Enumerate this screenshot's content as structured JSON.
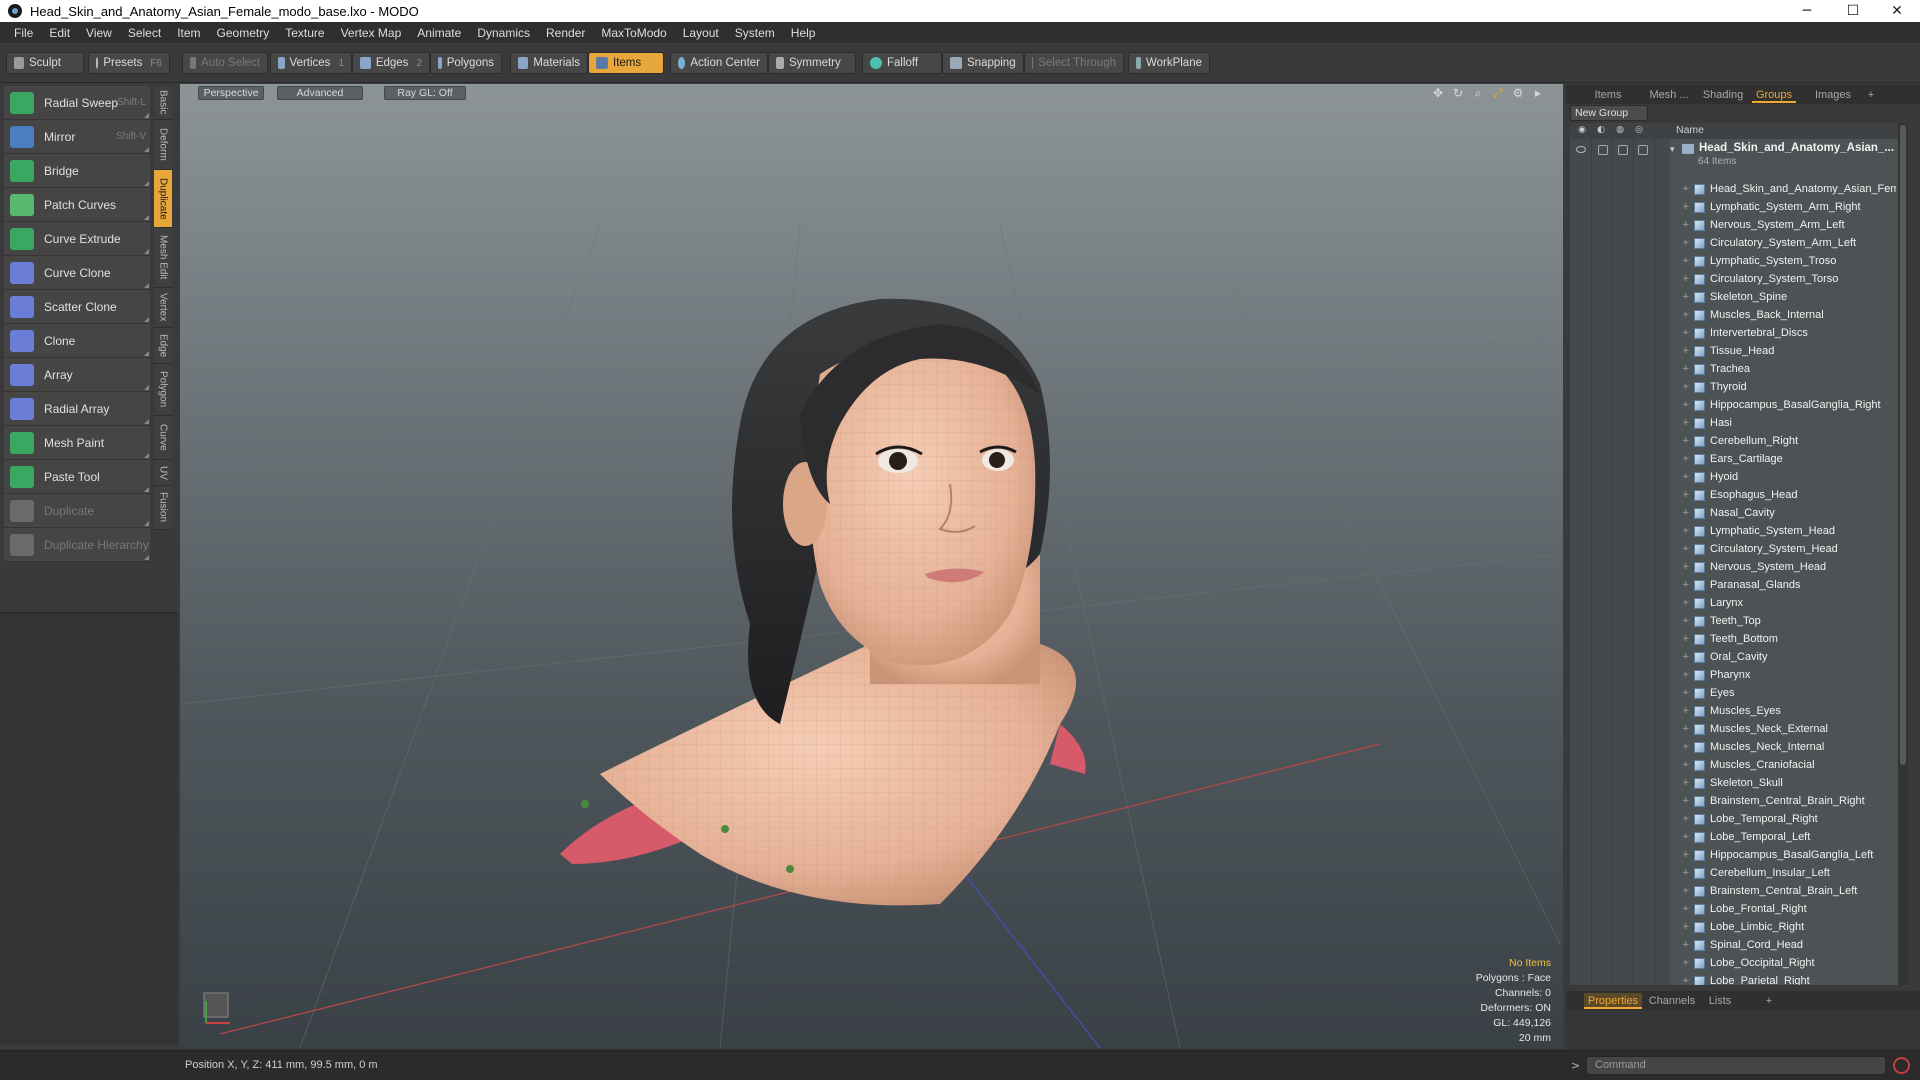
{
  "window": {
    "title": "Head_Skin_and_Anatomy_Asian_Female_modo_base.lxo - MODO",
    "minimize_glyph": "─",
    "maximize_glyph": "☐",
    "close_glyph": "✕"
  },
  "menu": [
    "File",
    "Edit",
    "View",
    "Select",
    "Item",
    "Geometry",
    "Texture",
    "Vertex Map",
    "Animate",
    "Dynamics",
    "Render",
    "MaxToModo",
    "Layout",
    "System",
    "Help"
  ],
  "toolbar": {
    "sculpt": "Sculpt",
    "presets": "Presets",
    "presets_shortcut": "F6",
    "auto_select": "Auto Select",
    "vertices": "Vertices",
    "vertices_num": "1",
    "edges": "Edges",
    "edges_num": "2",
    "polygons": "Polygons",
    "materials": "Materials",
    "items": "Items",
    "action_center": "Action Center",
    "symmetry": "Symmetry",
    "falloff": "Falloff",
    "snapping": "Snapping",
    "select_through": "Select Through",
    "workplane": "WorkPlane"
  },
  "tools": [
    {
      "label": "Radial Sweep",
      "shortcut": "Shift-L",
      "color": "#3aa860"
    },
    {
      "label": "Mirror",
      "shortcut": "Shift-V",
      "color": "#4a7ec0"
    },
    {
      "label": "Bridge",
      "shortcut": "",
      "color": "#3aa860"
    },
    {
      "label": "Patch Curves",
      "shortcut": "",
      "color": "#58b870"
    },
    {
      "label": "Curve Extrude",
      "shortcut": "",
      "color": "#3aa860"
    },
    {
      "label": "Curve Clone",
      "shortcut": "",
      "color": "#6a7ed8"
    },
    {
      "label": "Scatter Clone",
      "shortcut": "",
      "color": "#6a7ed8"
    },
    {
      "label": "Clone",
      "shortcut": "",
      "color": "#6a7ed8"
    },
    {
      "label": "Array",
      "shortcut": "",
      "color": "#6a7ed8"
    },
    {
      "label": "Radial Array",
      "shortcut": "",
      "color": "#6a7ed8"
    },
    {
      "label": "Mesh Paint",
      "shortcut": "",
      "color": "#3aa860"
    },
    {
      "label": "Paste Tool",
      "shortcut": "",
      "color": "#3aa860"
    },
    {
      "label": "Duplicate",
      "shortcut": "",
      "color": "#6a6a6a",
      "disabled": true
    },
    {
      "label": "Duplicate Hierarchy",
      "shortcut": "",
      "color": "#6a6a6a",
      "disabled": true
    }
  ],
  "vertical_tabs": [
    {
      "label": "Basic"
    },
    {
      "label": "Deform"
    },
    {
      "label": "Duplicate",
      "active": true
    },
    {
      "label": "Mesh Edit"
    },
    {
      "label": "Vertex"
    },
    {
      "label": "Edge"
    },
    {
      "label": "Polygon"
    },
    {
      "label": "Curve"
    },
    {
      "label": "UV"
    },
    {
      "label": "Fusion"
    }
  ],
  "viewport": {
    "tabs": [
      "Perspective",
      "Advanced",
      "Ray GL: Off"
    ],
    "info": {
      "no_items": "No Items",
      "polygons": "Polygons : Face",
      "channels": "Channels: 0",
      "deformers": "Deformers: ON",
      "gl": "GL: 449,126",
      "scale": "20 mm"
    }
  },
  "right_panel": {
    "tabs": [
      "Items",
      "Mesh ...",
      "Shading",
      "Groups",
      "Images",
      "+"
    ],
    "active_tab": "Groups",
    "new_group": "New Group",
    "column_name": "Name",
    "group_name": "Head_Skin_and_Anatomy_Asian_...",
    "group_count": "64 Items",
    "items": [
      "Head_Skin_and_Anatomy_Asian_Fem...",
      "Lymphatic_System_Arm_Right",
      "Nervous_System_Arm_Left",
      "Circulatory_System_Arm_Left",
      "Lymphatic_System_Troso",
      "Circulatory_System_Torso",
      "Skeleton_Spine",
      "Muscles_Back_Internal",
      "Intervertebral_Discs",
      "Tissue_Head",
      "Trachea",
      "Thyroid",
      "Hippocampus_BasalGanglia_Right",
      "Hasi",
      "Cerebellum_Right",
      "Ears_Cartilage",
      "Hyoid",
      "Esophagus_Head",
      "Nasal_Cavity",
      "Lymphatic_System_Head",
      "Circulatory_System_Head",
      "Nervous_System_Head",
      "Paranasal_Glands",
      "Larynx",
      "Teeth_Top",
      "Teeth_Bottom",
      "Oral_Cavity",
      "Pharynx",
      "Eyes",
      "Muscles_Eyes",
      "Muscles_Neck_External",
      "Muscles_Neck_Internal",
      "Muscles_Craniofacial",
      "Skeleton_Skull",
      "Brainstem_Central_Brain_Right",
      "Lobe_Temporal_Right",
      "Lobe_Temporal_Left",
      "Hippocampus_BasalGanglia_Left",
      "Cerebellum_Insular_Left",
      "Brainstem_Central_Brain_Left",
      "Lobe_Frontal_Right",
      "Lobe_Limbic_Right",
      "Spinal_Cord_Head",
      "Lobe_Occipital_Right",
      "Lobe_Parietal_Right"
    ],
    "bottom_tabs": [
      "Properties",
      "Channels",
      "Lists",
      "+"
    ]
  },
  "statusbar": {
    "position": "Position X, Y, Z:  411 mm, 99.5 mm, 0 m",
    "command_placeholder": "Command"
  },
  "colors": {
    "accent": "#e8a73a",
    "skin": "#e9b89c",
    "hair": "#2a2a2c"
  }
}
